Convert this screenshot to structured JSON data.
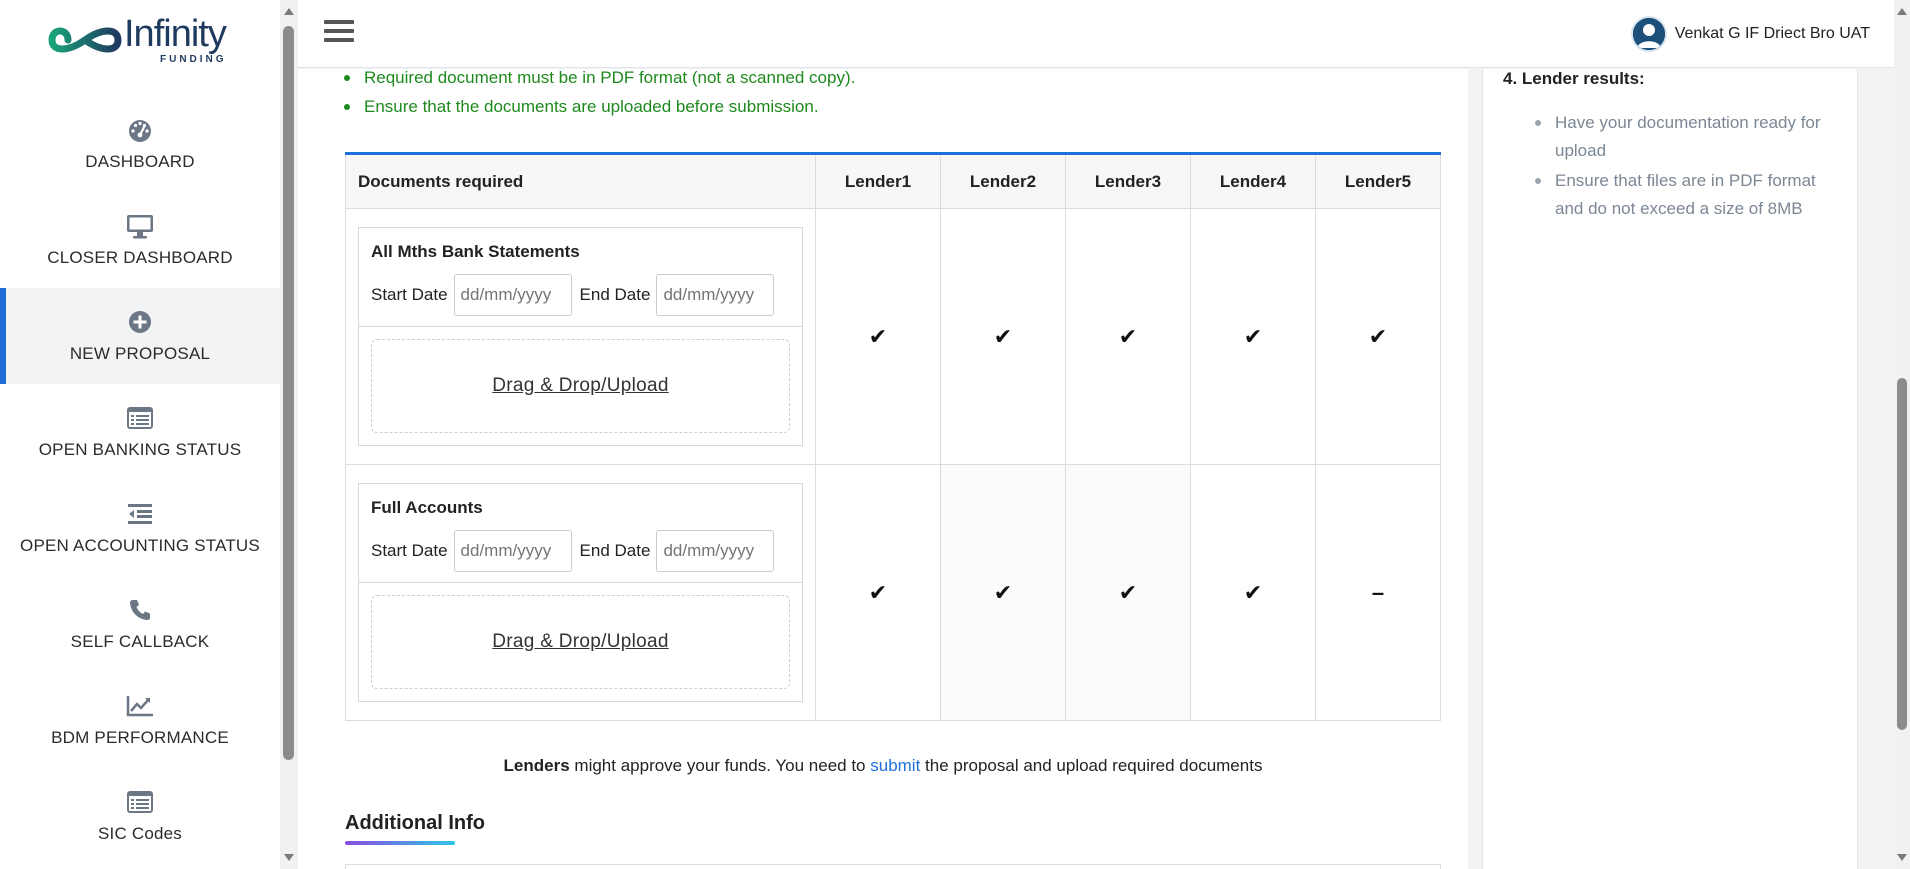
{
  "brand": {
    "name": "Infinity",
    "tagline": "FUNDING"
  },
  "sidebar": {
    "items": [
      {
        "label": "DASHBOARD",
        "icon": "dashboard-gauge-icon",
        "active": false
      },
      {
        "label": "CLOSER DASHBOARD",
        "icon": "monitor-icon",
        "active": false
      },
      {
        "label": "NEW PROPOSAL",
        "icon": "plus-circle-icon",
        "active": true
      },
      {
        "label": "OPEN BANKING STATUS",
        "icon": "list-window-icon",
        "active": false
      },
      {
        "label": "OPEN ACCOUNTING STATUS",
        "icon": "indent-list-icon",
        "active": false
      },
      {
        "label": "SELF CALLBACK",
        "icon": "phone-icon",
        "active": false
      },
      {
        "label": "BDM PERFORMANCE",
        "icon": "trend-chart-icon",
        "active": false
      },
      {
        "label": "SIC Codes",
        "icon": "list-window-icon",
        "active": false
      }
    ]
  },
  "header": {
    "user_name": "Venkat G IF Driect Bro UAT"
  },
  "requirements": [
    "Required document must be in PDF format (not a scanned copy).",
    "Ensure that the documents are uploaded before submission."
  ],
  "table": {
    "header_doc": "Documents required",
    "lenders": [
      "Lender1",
      "Lender2",
      "Lender3",
      "Lender4",
      "Lender5"
    ],
    "rows": [
      {
        "title": "All Mths Bank Statements",
        "start_label": "Start Date",
        "end_label": "End Date",
        "start_placeholder": "dd/mm/yyyy",
        "end_placeholder": "dd/mm/yyyy",
        "upload_label": "Drag & Drop/Upload",
        "marks": [
          "✔",
          "✔",
          "✔",
          "✔",
          "✔"
        ]
      },
      {
        "title": "Full Accounts",
        "start_label": "Start Date",
        "end_label": "End Date",
        "start_placeholder": "dd/mm/yyyy",
        "end_placeholder": "dd/mm/yyyy",
        "upload_label": "Drag & Drop/Upload",
        "marks": [
          "✔",
          "✔",
          "✔",
          "✔",
          "–"
        ]
      }
    ]
  },
  "note": {
    "bold": "Lenders",
    "part1": " might approve your funds. You need to ",
    "link": "submit",
    "part2": " the proposal and upload required documents"
  },
  "additional_info": {
    "title": "Additional Info"
  },
  "right_panel": {
    "title": "4. Lender results:",
    "items": [
      "Have your documentation ready for upload",
      "Ensure that files are in PDF format and do not exceed a size of 8MB"
    ]
  },
  "colors": {
    "accent": "#1e6fd9",
    "success": "#1e8a1e",
    "muted": "#7b8794"
  }
}
